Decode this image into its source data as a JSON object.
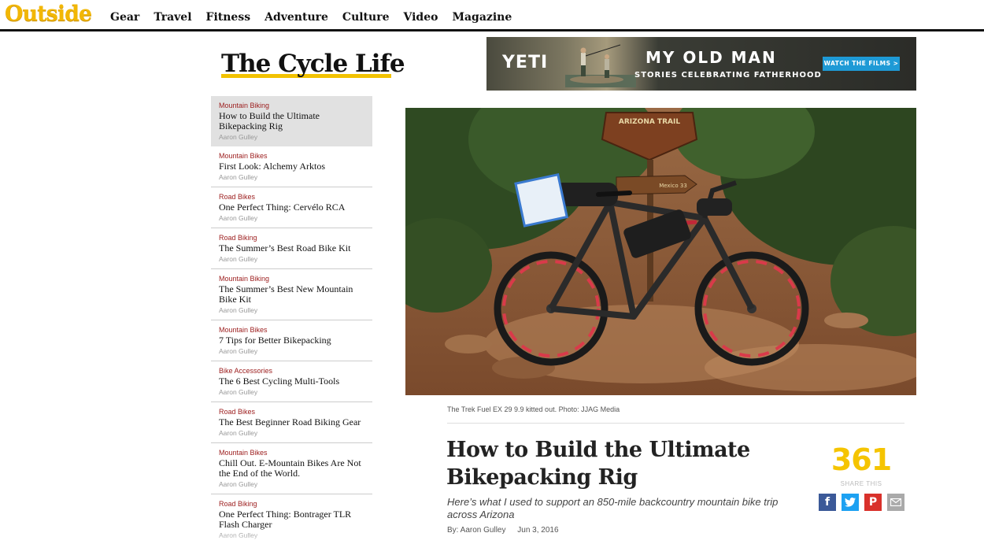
{
  "site": {
    "logo": "Outside",
    "nav": [
      "Gear",
      "Travel",
      "Fitness",
      "Adventure",
      "Culture",
      "Video",
      "Magazine"
    ]
  },
  "blog": {
    "title": "The Cycle Life"
  },
  "ad": {
    "brand": "YETI",
    "headline": "MY OLD MAN",
    "subhead": "STORIES CELEBRATING FATHERHOOD",
    "cta": "WATCH THE FILMS >"
  },
  "sidebar": {
    "items": [
      {
        "category": "Mountain Biking",
        "title": "How to Build the Ultimate Bikepacking Rig",
        "author": "Aaron Gulley",
        "active": true
      },
      {
        "category": "Mountain Bikes",
        "title": "First Look: Alchemy Arktos",
        "author": "Aaron Gulley"
      },
      {
        "category": "Road Bikes",
        "title": "One Perfect Thing: Cervélo RCA",
        "author": "Aaron Gulley"
      },
      {
        "category": "Road Biking",
        "title": "The Summer’s Best Road Bike Kit",
        "author": "Aaron Gulley"
      },
      {
        "category": "Mountain Biking",
        "title": "The Summer’s Best New Mountain Bike Kit",
        "author": "Aaron Gulley"
      },
      {
        "category": "Mountain Bikes",
        "title": "7 Tips for Better Bikepacking",
        "author": "Aaron Gulley"
      },
      {
        "category": "Bike Accessories",
        "title": "The 6 Best Cycling Multi-Tools",
        "author": "Aaron Gulley"
      },
      {
        "category": "Road Bikes",
        "title": "The Best Beginner Road Biking Gear",
        "author": "Aaron Gulley"
      },
      {
        "category": "Mountain Bikes",
        "title": "Chill Out. E-Mountain Bikes Are Not the End of the World.",
        "author": "Aaron Gulley"
      },
      {
        "category": "Road Biking",
        "title": "One Perfect Thing: Bontrager TLR Flash Charger",
        "author": "Aaron Gulley"
      }
    ]
  },
  "hero": {
    "sign_top": "ARIZONA TRAIL",
    "sign_arrow": "Mexico 33"
  },
  "article": {
    "caption": "The Trek Fuel EX 29 9.9 kitted out. Photo: JJAG Media",
    "headline": "How to Build the Ultimate Bikepacking Rig",
    "dek": "Here’s what I used to support an 850-mile backcountry mountain bike trip across Arizona",
    "byline": "By: Aaron Gulley",
    "date": "Jun 3, 2016"
  },
  "share": {
    "count": "361",
    "label": "SHARE THIS",
    "icons": [
      "facebook-icon",
      "twitter-icon",
      "pinterest-icon",
      "email-icon"
    ]
  },
  "colors": {
    "brand_yellow": "#f2b705",
    "category_red": "#9b1b1b",
    "share_yellow": "#f5c400",
    "facebook": "#3b5998",
    "twitter": "#1da1f2",
    "pinterest": "#d9312b"
  }
}
